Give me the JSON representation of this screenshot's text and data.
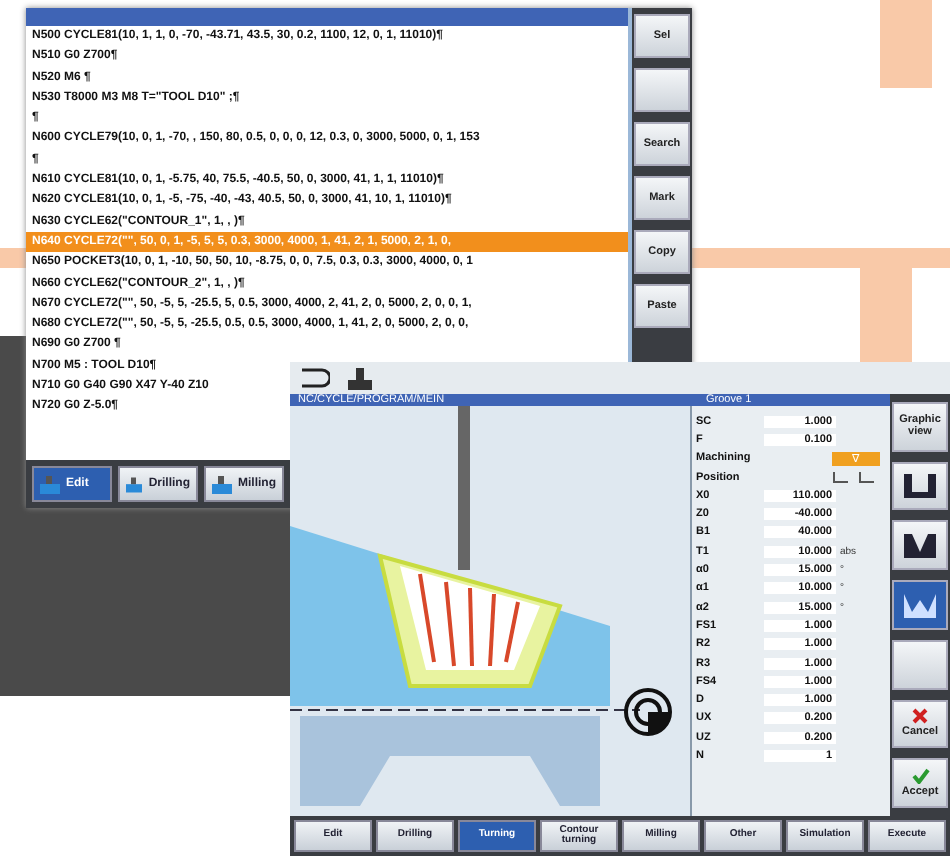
{
  "editor": {
    "lines": [
      {
        "text": "N500 CYCLE81(10, 1, 1, 0, -70, -43.71, 43.5, 30, 0.2, 1100, 12, 0, 1, 11010)¶",
        "selected": false
      },
      {
        "text": "N510 G0 Z700¶",
        "selected": false
      },
      {
        "text": "N520 M6 ¶",
        "selected": false
      },
      {
        "text": "N530 T8000 M3 M8 T=\"TOOL D10\" ;¶",
        "selected": false
      },
      {
        "text": "¶",
        "selected": false
      },
      {
        "text": "N600 CYCLE79(10, 0, 1, -70, , 150, 80, 0.5, 0, 0, 0, 12, 0.3, 0, 3000, 5000, 0, 1, 153",
        "selected": false
      },
      {
        "text": "¶",
        "selected": false
      },
      {
        "text": "N610 CYCLE81(10, 0, 1, -5.75, 40, 75.5, -40.5, 50, 0, 3000, 41, 1, 1, 11010)¶",
        "selected": false
      },
      {
        "text": "N620 CYCLE81(10, 0, 1, -5, -75, -40, -43, 40.5, 50, 0, 3000, 41, 10, 1, 11010)¶",
        "selected": false
      },
      {
        "text": "N630 CYCLE62(\"CONTOUR_1\", 1, , )¶",
        "selected": false
      },
      {
        "text": "N640 CYCLE72(\"\", 50, 0, 1, -5, 5, 5, 0.3, 3000, 4000, 1, 41, 2, 1, 5000, 2, 1, 0,",
        "selected": true
      },
      {
        "text": "N650 POCKET3(10, 0, 1, -10, 50, 50, 10, -8.75, 0, 0, 7.5, 0.3, 0.3, 3000, 4000, 0, 1",
        "selected": false
      },
      {
        "text": "N660 CYCLE62(\"CONTOUR_2\", 1, , )¶",
        "selected": false
      },
      {
        "text": "N670 CYCLE72(\"\", 50, -5, 5, -25.5, 5, 0.5, 3000, 4000, 2, 41, 2, 0, 5000, 2, 0, 0, 1,",
        "selected": false
      },
      {
        "text": "N680 CYCLE72(\"\", 50, -5, 5, -25.5, 0.5, 0.5, 3000, 4000, 1, 41, 2, 0, 5000, 2, 0, 0,",
        "selected": false
      },
      {
        "text": "N690 G0 Z700 ¶",
        "selected": false
      },
      {
        "text": "N700 M5 : TOOL D10¶",
        "selected": false
      },
      {
        "text": "N710 G0 G40 G90 X47 Y-40 Z10",
        "selected": false
      },
      {
        "text": "N720 G0 Z-5.0¶",
        "selected": false
      }
    ],
    "softkeys": [
      {
        "kind": "text",
        "label": "Sel"
      },
      {
        "kind": "blank"
      },
      {
        "kind": "text",
        "label": "Search"
      },
      {
        "kind": "text",
        "label": "Mark"
      },
      {
        "kind": "text",
        "label": "Copy"
      },
      {
        "kind": "text",
        "label": "Paste"
      }
    ],
    "tabs": [
      {
        "label": "Edit",
        "selected": true
      },
      {
        "label": "Drilling",
        "selected": false
      },
      {
        "label": "Milling",
        "selected": false
      }
    ]
  },
  "cycle": {
    "path": "NC/CYCLE/PROGRAM/MEIN",
    "panel_title": "Groove 1",
    "params": [
      {
        "kind": "value",
        "name": "SC",
        "value": "1.000"
      },
      {
        "kind": "value",
        "name": "F",
        "value": "0.100"
      },
      {
        "kind": "select",
        "name": "Machining",
        "value": "∇"
      },
      {
        "kind": "position",
        "name": "Position"
      },
      {
        "kind": "value",
        "name": "X0",
        "value": "110.000"
      },
      {
        "kind": "value",
        "name": "Z0",
        "value": "-40.000"
      },
      {
        "kind": "value",
        "name": "B1",
        "value": "40.000"
      },
      {
        "kind": "value",
        "name": "T1",
        "value": "10.000",
        "unit": "abs"
      },
      {
        "kind": "value",
        "name": "α0",
        "value": "15.000",
        "unit": "°"
      },
      {
        "kind": "value",
        "name": "α1",
        "value": "10.000",
        "unit": "°"
      },
      {
        "kind": "value",
        "name": "α2",
        "value": "15.000",
        "unit": "°"
      },
      {
        "kind": "value",
        "name": "FS1",
        "value": "1.000"
      },
      {
        "kind": "value",
        "name": "R2",
        "value": "1.000"
      },
      {
        "kind": "value",
        "name": "R3",
        "value": "1.000"
      },
      {
        "kind": "value",
        "name": "FS4",
        "value": "1.000"
      },
      {
        "kind": "value",
        "name": "D",
        "value": "1.000"
      },
      {
        "kind": "value",
        "name": "UX",
        "value": "0.200"
      },
      {
        "kind": "value",
        "name": "UZ",
        "value": "0.200"
      },
      {
        "kind": "value",
        "name": "N",
        "value": "1"
      }
    ],
    "side_softkeys": [
      {
        "kind": "text",
        "label": "Graphic view"
      },
      {
        "kind": "groove",
        "selected": false
      },
      {
        "kind": "v-groove",
        "selected": false
      },
      {
        "kind": "wave-groove",
        "selected": true
      },
      {
        "kind": "blank"
      },
      {
        "kind": "cancel",
        "label": "Cancel"
      },
      {
        "kind": "accept",
        "label": "Accept"
      }
    ],
    "tabs": [
      {
        "label": "Edit",
        "selected": false
      },
      {
        "label": "Drilling",
        "selected": false
      },
      {
        "label": "Turning",
        "selected": true
      },
      {
        "label": "Contour turning",
        "selected": false
      },
      {
        "label": "Milling",
        "selected": false
      },
      {
        "label": "Other",
        "selected": false
      },
      {
        "label": "Simulation",
        "selected": false
      },
      {
        "label": "Execute",
        "selected": false
      }
    ]
  }
}
